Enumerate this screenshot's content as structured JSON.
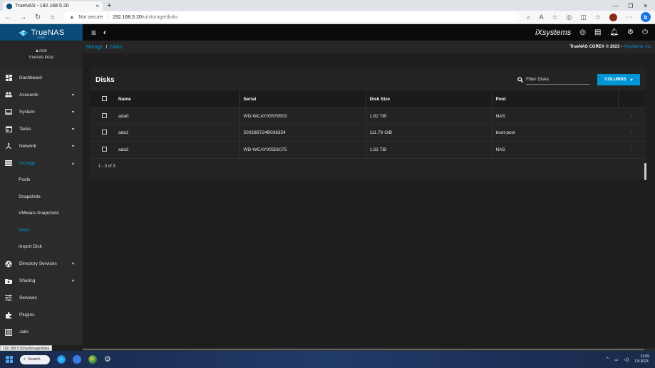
{
  "browser": {
    "tab_title": "TrueNAS - 192.168.5.20",
    "tab_close": "×",
    "new_tab": "+",
    "not_secure": "Not secure",
    "url_host": "192.168.5.20",
    "url_path": "/ui/storage/disks",
    "status_url": "192.168.5.20/ui/storage/disks"
  },
  "app": {
    "brand": "TrueNAS",
    "brand_sub": "CORE",
    "vendor": "iXsystems",
    "copyright_prefix": "TrueNAS CORE® © 2023 - ",
    "copyright_link": "iXsystems, Inc."
  },
  "user": {
    "name": "root",
    "host": "truenas.local"
  },
  "sidebar": {
    "items": [
      {
        "label": "Dashboard",
        "icon": "dashboard-icon"
      },
      {
        "label": "Accounts",
        "icon": "accounts-icon",
        "caret": "▾"
      },
      {
        "label": "System",
        "icon": "system-icon",
        "caret": "▾"
      },
      {
        "label": "Tasks",
        "icon": "tasks-icon",
        "caret": "▾"
      },
      {
        "label": "Network",
        "icon": "network-icon",
        "caret": "▾"
      },
      {
        "label": "Storage",
        "icon": "storage-icon",
        "caret": "▴"
      }
    ],
    "storage_sub": [
      "Pools",
      "Snapshots",
      "VMware-Snapshots",
      "Disks",
      "Import Disk"
    ],
    "items_after": [
      {
        "label": "Directory Services",
        "icon": "directory-icon",
        "caret": "▾"
      },
      {
        "label": "Sharing",
        "icon": "sharing-icon",
        "caret": "▾"
      },
      {
        "label": "Services",
        "icon": "services-icon"
      },
      {
        "label": "Plugins",
        "icon": "plugins-icon"
      },
      {
        "label": "Jails",
        "icon": "jails-icon"
      }
    ]
  },
  "breadcrumb": {
    "parent": "Storage",
    "separator": "/",
    "current": "Disks"
  },
  "disks": {
    "title": "Disks",
    "filter_placeholder": "Filter Disks",
    "columns_label": "COLUMNS",
    "headers": [
      "Name",
      "Serial",
      "Disk Size",
      "Pool"
    ],
    "rows": [
      {
        "name": "ada0",
        "serial": "WD-WCAY00578503",
        "size": "1.82 TiB",
        "pool": "NAS"
      },
      {
        "name": "ada1",
        "serial": "50026B724B036354",
        "size": "111.79 GiB",
        "pool": "boot-pool"
      },
      {
        "name": "ada2",
        "serial": "WD-WCAY00581075",
        "size": "1.82 TiB",
        "pool": "NAS"
      }
    ],
    "pager": "1 - 3 of 3"
  },
  "taskbar": {
    "search_label": "Search",
    "time": "21:05",
    "date": "7.8.2023."
  },
  "colors": {
    "accent": "#0095d5",
    "brand_bg": "#0a4b78",
    "sidebar_bg": "#2b2b2b",
    "content_bg": "#1e1e1e"
  }
}
